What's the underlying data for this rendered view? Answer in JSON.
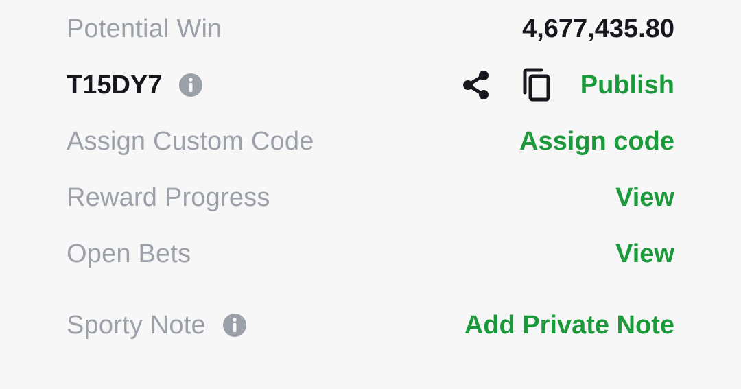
{
  "potential_win": {
    "label": "Potential Win",
    "value": "4,677,435.80"
  },
  "booking": {
    "code": "T15DY7",
    "info_icon": "info-icon",
    "share_icon": "share-icon",
    "copy_icon": "copy-icon",
    "publish_label": "Publish"
  },
  "custom_code": {
    "label": "Assign Custom Code",
    "action": "Assign code"
  },
  "reward_progress": {
    "label": "Reward Progress",
    "action": "View"
  },
  "open_bets": {
    "label": "Open Bets",
    "action": "View"
  },
  "sporty_note": {
    "label": "Sporty Note",
    "info_icon": "info-icon",
    "action": "Add Private Note"
  },
  "colors": {
    "background": "#f7f7f8",
    "label_gray": "#9ca0a8",
    "text_dark": "#16181d",
    "accent_green": "#1c9a3b"
  }
}
